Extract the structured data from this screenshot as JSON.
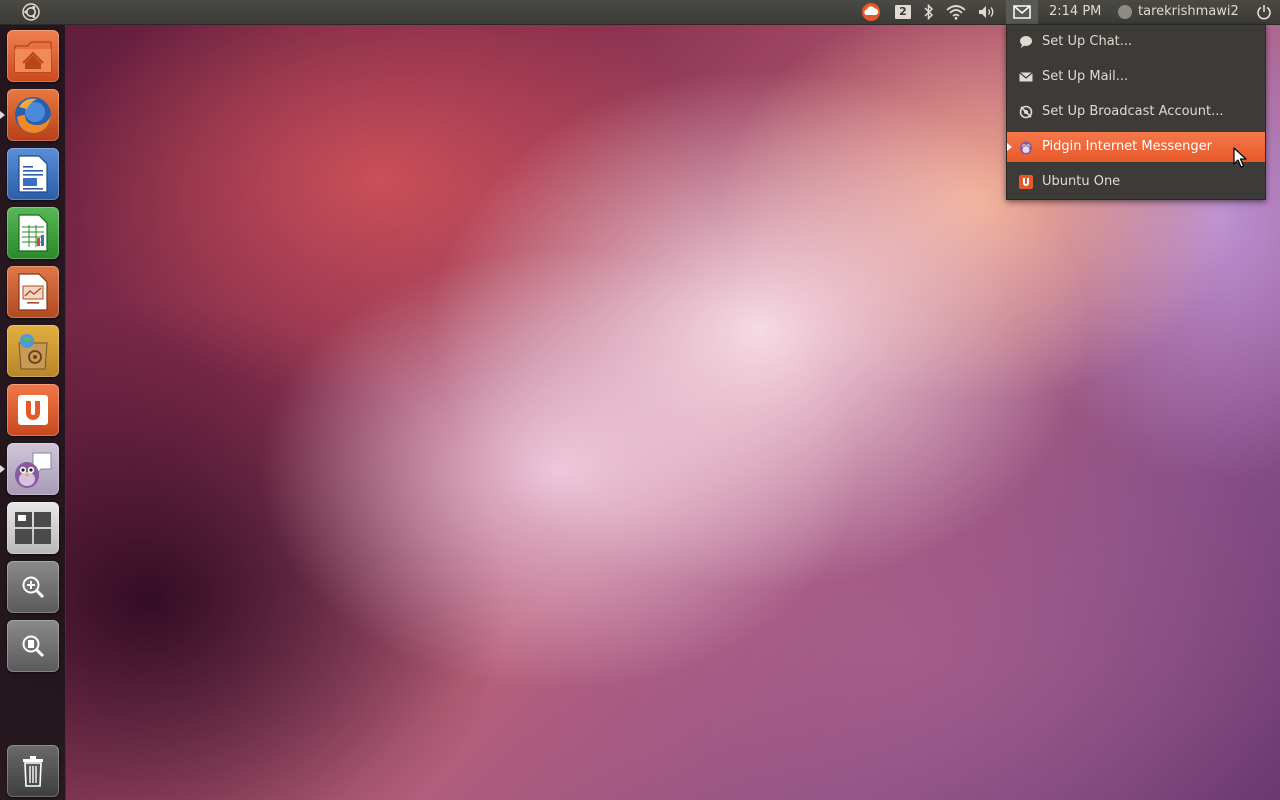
{
  "top_panel": {
    "workspace_number": "2",
    "clock": "2:14 PM",
    "username": "tarekrishmawi2",
    "icons": [
      "ubuntu-logo-icon",
      "ubuntu-one-cloud-icon",
      "workspace-icon",
      "bluetooth-icon",
      "wifi-icon",
      "volume-icon",
      "envelope-icon",
      "user-status-icon",
      "power-icon"
    ]
  },
  "launcher": {
    "items": [
      {
        "name": "home-folder",
        "icon": "home-folder-icon",
        "running": false
      },
      {
        "name": "firefox",
        "icon": "firefox-icon",
        "running": true
      },
      {
        "name": "libreoffice-writer",
        "icon": "writer-document-icon",
        "running": false
      },
      {
        "name": "libreoffice-calc",
        "icon": "calc-spreadsheet-icon",
        "running": false
      },
      {
        "name": "libreoffice-impress",
        "icon": "impress-presentation-icon",
        "running": false
      },
      {
        "name": "ubuntu-software-center",
        "icon": "software-center-bag-icon",
        "running": false
      },
      {
        "name": "ubuntu-one",
        "icon": "ubuntu-one-icon",
        "running": false
      },
      {
        "name": "pidgin",
        "icon": "pidgin-bird-icon",
        "running": true
      },
      {
        "name": "workspace-switcher",
        "icon": "workspace-grid-icon",
        "running": false
      },
      {
        "name": "dash-applications",
        "icon": "magnifier-plus-icon",
        "running": false
      },
      {
        "name": "dash-files",
        "icon": "magnifier-files-icon",
        "running": false
      },
      {
        "name": "trash",
        "icon": "trash-icon",
        "running": false
      }
    ]
  },
  "messaging_menu": {
    "items": [
      {
        "label": "Set Up Chat...",
        "icon": "chat-bubble-icon",
        "highlighted": false
      },
      {
        "label": "Set Up Mail...",
        "icon": "mail-icon",
        "highlighted": false
      },
      {
        "label": "Set Up Broadcast Account...",
        "icon": "broadcast-icon",
        "highlighted": false
      },
      {
        "label": "Pidgin Internet Messenger",
        "icon": "pidgin-small-icon",
        "highlighted": true
      },
      {
        "label": "Ubuntu One",
        "icon": "ubuntu-one-small-icon",
        "highlighted": false
      }
    ]
  },
  "colors": {
    "panel": "#3c3b37",
    "highlight": "#e8592a",
    "text": "#dfdbd2"
  }
}
